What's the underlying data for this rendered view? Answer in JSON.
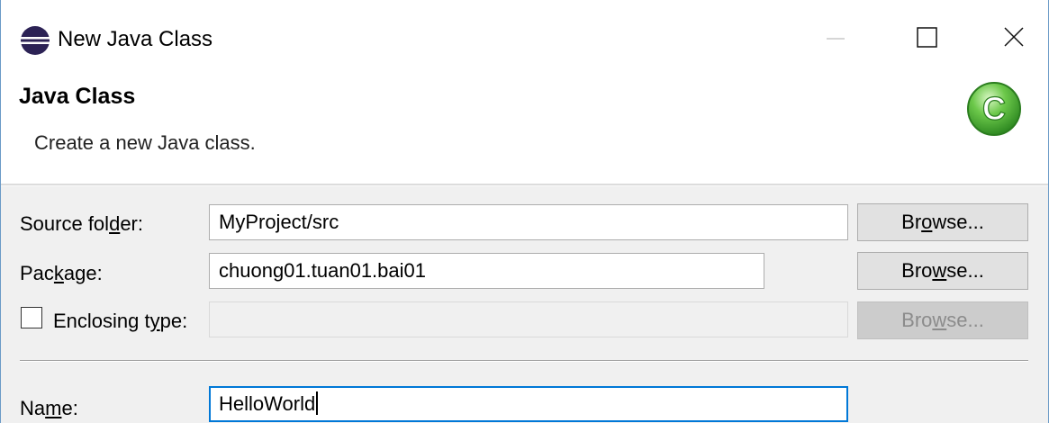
{
  "window": {
    "title": "New Java Class",
    "icon": "eclipse-icon"
  },
  "banner": {
    "title": "Java Class",
    "description": "Create a new Java class.",
    "logo": "java-class-icon",
    "logo_letter": "C",
    "logo_color": "#3aa83a"
  },
  "form": {
    "source_folder": {
      "label_pre": "Source fol",
      "label_mnemonic": "d",
      "label_post": "er:",
      "value": "MyProject/src",
      "browse_pre": "Br",
      "browse_mnemonic": "o",
      "browse_post": "wse..."
    },
    "package": {
      "label_pre": "Pac",
      "label_mnemonic": "k",
      "label_post": "age:",
      "value": "chuong01.tuan01.bai01",
      "browse_pre": "Bro",
      "browse_mnemonic": "w",
      "browse_post": "se..."
    },
    "enclosing_type": {
      "label_pre": "Enclosing t",
      "label_mnemonic": "y",
      "label_post": "pe:",
      "value": "",
      "checked": false,
      "browse_pre": "Bro",
      "browse_mnemonic": "w",
      "browse_post": "se..."
    },
    "name": {
      "label_pre": "Na",
      "label_mnemonic": "m",
      "label_post": "e:",
      "value": "HelloWorld"
    }
  },
  "colors": {
    "accent": "#0078d7",
    "window_border": "#6b9ac7"
  }
}
